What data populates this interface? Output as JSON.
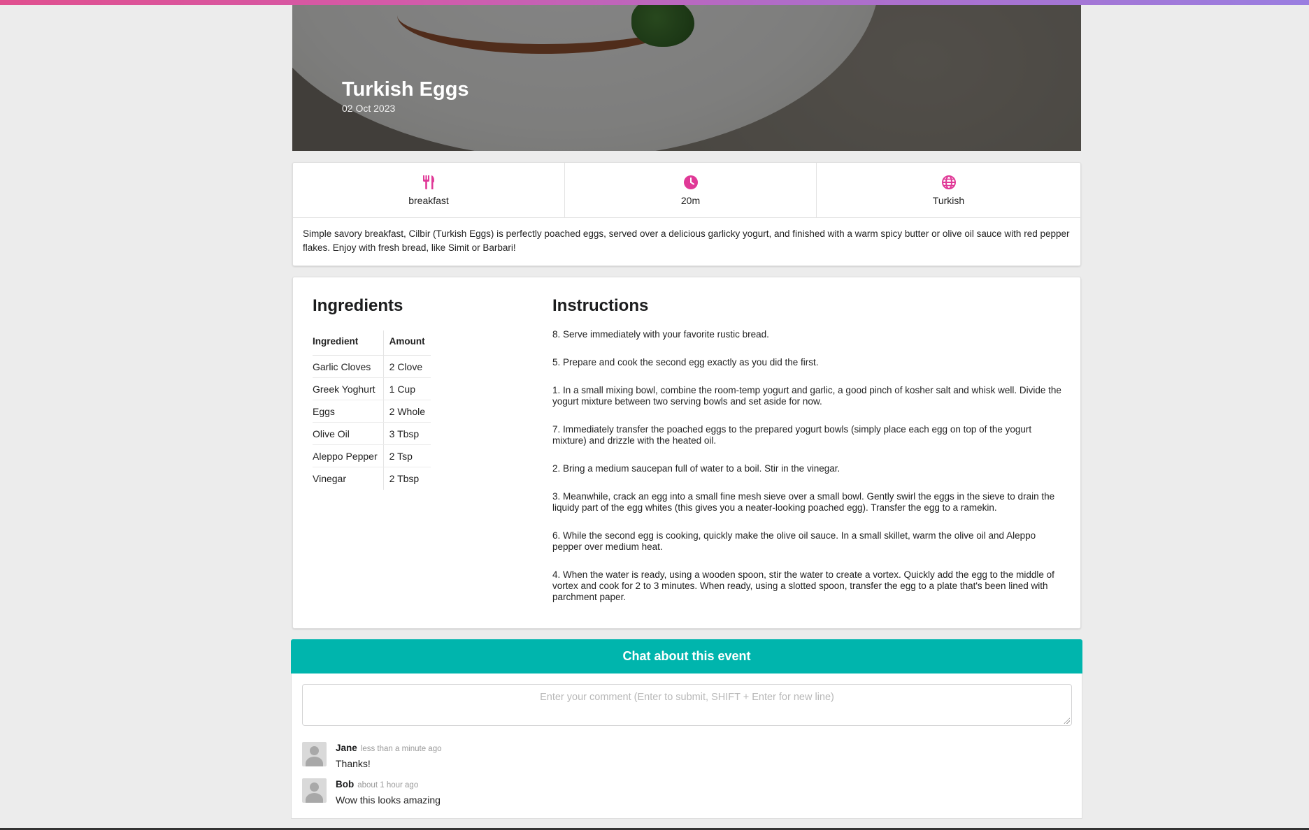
{
  "colors": {
    "accent": "#e03997",
    "chat_header": "#00b5ad",
    "top_bar_gradient_start": "#e0508f",
    "top_bar_gradient_end": "#9a7ee0"
  },
  "hero": {
    "title": "Turkish Eggs",
    "date": "02 Oct 2023"
  },
  "meta": {
    "items": [
      {
        "icon": "utensils-icon",
        "label": "breakfast"
      },
      {
        "icon": "clock-icon",
        "label": "20m"
      },
      {
        "icon": "globe-icon",
        "label": "Turkish"
      }
    ],
    "description": "Simple savory breakfast, Cilbir (Turkish Eggs) is perfectly poached eggs, served over a delicious garlicky yogurt, and finished with a warm spicy butter or olive oil sauce with red pepper flakes. Enjoy with fresh bread, like Simit or Barbari!"
  },
  "ingredients": {
    "title": "Ingredients",
    "columns": [
      "Ingredient",
      "Amount"
    ],
    "rows": [
      [
        "Garlic Cloves",
        "2 Clove"
      ],
      [
        "Greek Yoghurt",
        "1 Cup"
      ],
      [
        "Eggs",
        "2 Whole"
      ],
      [
        "Olive Oil",
        "3 Tbsp"
      ],
      [
        "Aleppo Pepper",
        "2 Tsp"
      ],
      [
        "Vinegar",
        "2 Tbsp"
      ]
    ]
  },
  "instructions": {
    "title": "Instructions",
    "steps": [
      "8. Serve immediately with your favorite rustic bread.",
      "5. Prepare and cook the second egg exactly as you did the first.",
      "1. In a small mixing bowl, combine the room-temp yogurt and garlic, a good pinch of kosher salt and whisk well. Divide the yogurt mixture between two serving bowls and set aside for now.",
      "7. Immediately transfer the poached eggs to the prepared yogurt bowls (simply place each egg on top of the yogurt mixture) and drizzle with the heated oil.",
      "2. Bring a medium saucepan full of water to a boil. Stir in the vinegar.",
      "3. Meanwhile, crack an egg into a small fine mesh sieve over a small bowl. Gently swirl the eggs in the sieve to drain the liquidy part of the egg whites (this gives you a neater-looking poached egg). Transfer the egg to a ramekin.",
      "6. While the second egg is cooking, quickly make the olive oil sauce. In a small skillet, warm the olive oil and Aleppo pepper over medium heat.",
      "4. When the water is ready, using a wooden spoon, stir the water to create a vortex. Quickly add the egg to the middle of vortex and cook for 2 to 3 minutes. When ready, using a slotted spoon, transfer the egg to a plate that's been lined with parchment paper."
    ]
  },
  "chat": {
    "title": "Chat about this event",
    "placeholder": "Enter your comment (Enter to submit, SHIFT + Enter for new line)",
    "comments": [
      {
        "author": "Jane",
        "time": "less than a minute ago",
        "text": "Thanks!"
      },
      {
        "author": "Bob",
        "time": "about 1 hour ago",
        "text": "Wow this looks amazing"
      }
    ]
  }
}
